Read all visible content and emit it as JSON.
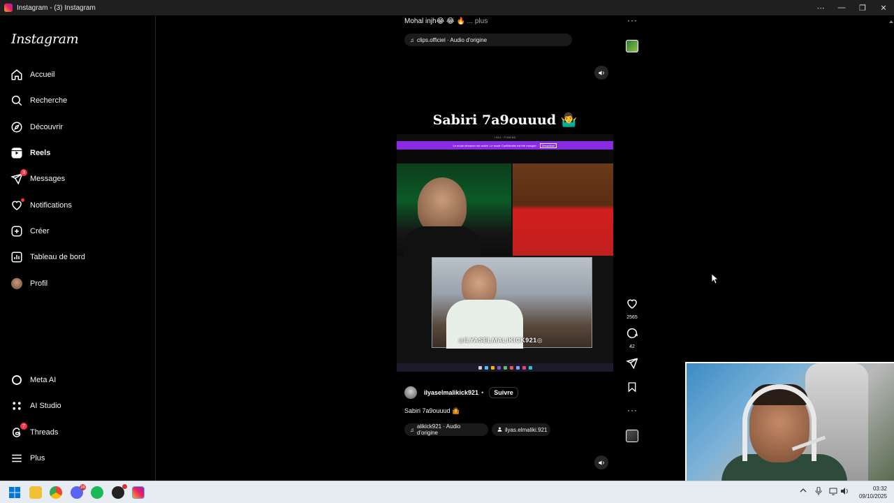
{
  "window": {
    "title": "Instagram - (3) Instagram",
    "controls": {
      "more": "⋯",
      "minimize": "—",
      "restore": "❐",
      "close": "✕"
    }
  },
  "sidebar": {
    "logo": "Instagram",
    "items": [
      {
        "label": "Accueil",
        "icon": "home-icon"
      },
      {
        "label": "Recherche",
        "icon": "search-icon"
      },
      {
        "label": "Découvrir",
        "icon": "compass-icon"
      },
      {
        "label": "Reels",
        "icon": "reels-icon",
        "active": true
      },
      {
        "label": "Messages",
        "icon": "messenger-icon",
        "badge": "3"
      },
      {
        "label": "Notifications",
        "icon": "heart-icon",
        "dot": true
      },
      {
        "label": "Créer",
        "icon": "plus-square-icon"
      },
      {
        "label": "Tableau de bord",
        "icon": "dashboard-icon"
      },
      {
        "label": "Profil",
        "icon": "avatar"
      }
    ],
    "bottom_items": [
      {
        "label": "Meta AI",
        "icon": "meta-ai-icon"
      },
      {
        "label": "AI Studio",
        "icon": "ai-studio-icon"
      },
      {
        "label": "Threads",
        "icon": "threads-icon",
        "badge": "7"
      },
      {
        "label": "Plus",
        "icon": "menu-icon"
      }
    ]
  },
  "prev_reel": {
    "caption": "Mohal injh😂 😂 🔥",
    "more": "... plus",
    "audio": "clips.officiel · Audio d'origine"
  },
  "reel": {
    "title": "Sabiri 7a9ouuud 🤷‍♂️",
    "video_top_text": "I KILL · FI AM BD",
    "video_banner": "Le mode streamer est activé. Le mode Confidentiel est été masqué.",
    "video_banner_button": "Désactiver",
    "cam_tag": "◎ILYASELMALIKICK921◎",
    "author": "ilyaselmalikick921",
    "separator": "•",
    "follow": "Suivre",
    "caption": "Sabiri 7a9ouuud 🤷",
    "audio": "alikick921 · Audio d'origine",
    "tagged_user": "ilyas.elmaliki.921",
    "likes": "2565",
    "comments": "42"
  },
  "icons": {
    "note": "♫",
    "person": "👤",
    "sound": "🔊",
    "more": "···"
  },
  "taskbar": {
    "discord_badge": "38",
    "time": "03:32",
    "date": "09/10/2025"
  }
}
